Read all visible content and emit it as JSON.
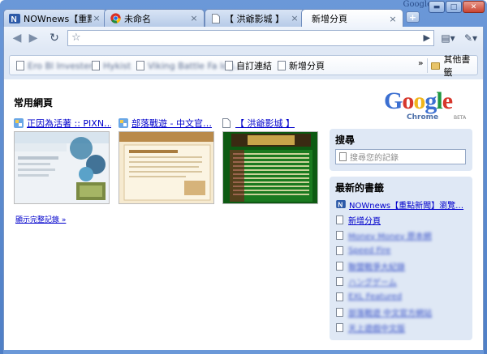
{
  "window": {
    "title": "Google",
    "minimize_glyph": "▬",
    "maximize_glyph": "□",
    "close_glyph": "✕"
  },
  "tabs": [
    {
      "label": "NOWnews【重點…",
      "icon": "nownews-icon",
      "active": false
    },
    {
      "label": "未命名",
      "icon": "chrome-icon",
      "active": false
    },
    {
      "label": "【 洪爺影城 】",
      "icon": "page-icon",
      "active": false
    },
    {
      "label": "新增分頁",
      "icon": "none",
      "active": true
    }
  ],
  "tab_close_glyph": "×",
  "new_tab_glyph": "+",
  "toolbar": {
    "back_glyph": "◀",
    "forward_glyph": "▶",
    "reload_glyph": "↻",
    "star_glyph": "☆",
    "go_glyph": "▶",
    "page_menu_glyph": "▤▾",
    "tools_menu_glyph": "✎▾",
    "url": ""
  },
  "bookmark_bar": {
    "items": [
      {
        "label": "Ero Bl Invester"
      },
      {
        "label": "Hykist"
      },
      {
        "label": "Viking Battle Fa log…"
      },
      {
        "label": "自訂連結"
      },
      {
        "label": "新增分頁"
      }
    ],
    "more_glyph": "»",
    "other_bookmarks": "其他書籤"
  },
  "most_visited": {
    "title": "常用網頁",
    "thumbnails": [
      {
        "title": "正因為活著 :: PIXN…"
      },
      {
        "title": "部落戰遊 - 中文官…"
      },
      {
        "title": "【 洪爺影城 】"
      }
    ],
    "show_all": "顯示完整記錄 »"
  },
  "logo": {
    "word": "Google",
    "sub": "Chrome",
    "beta": "BETA"
  },
  "search_panel": {
    "title": "搜尋",
    "placeholder": "搜尋您的記錄"
  },
  "bookmarks_panel": {
    "title": "最新的書籤",
    "items": [
      {
        "label": "NOWnews【重點新聞】瀏覽…",
        "blurred": false
      },
      {
        "label": "新增分頁",
        "blurred": false
      },
      {
        "label": "Money Money 原本網",
        "blurred": true
      },
      {
        "label": "Speed Fire",
        "blurred": true
      },
      {
        "label": "聯盟戰爭大紀錄",
        "blurred": true
      },
      {
        "label": "ハングゲーム",
        "blurred": true
      },
      {
        "label": "EXL Featured",
        "blurred": true
      },
      {
        "label": "部落戰遊 中文官方網站",
        "blurred": true
      },
      {
        "label": "天上遊戲中文版",
        "blurred": true
      }
    ]
  },
  "colors": {
    "frame": "#6b98d8",
    "panel": "#dfe8f5",
    "link": "#0000cc"
  }
}
